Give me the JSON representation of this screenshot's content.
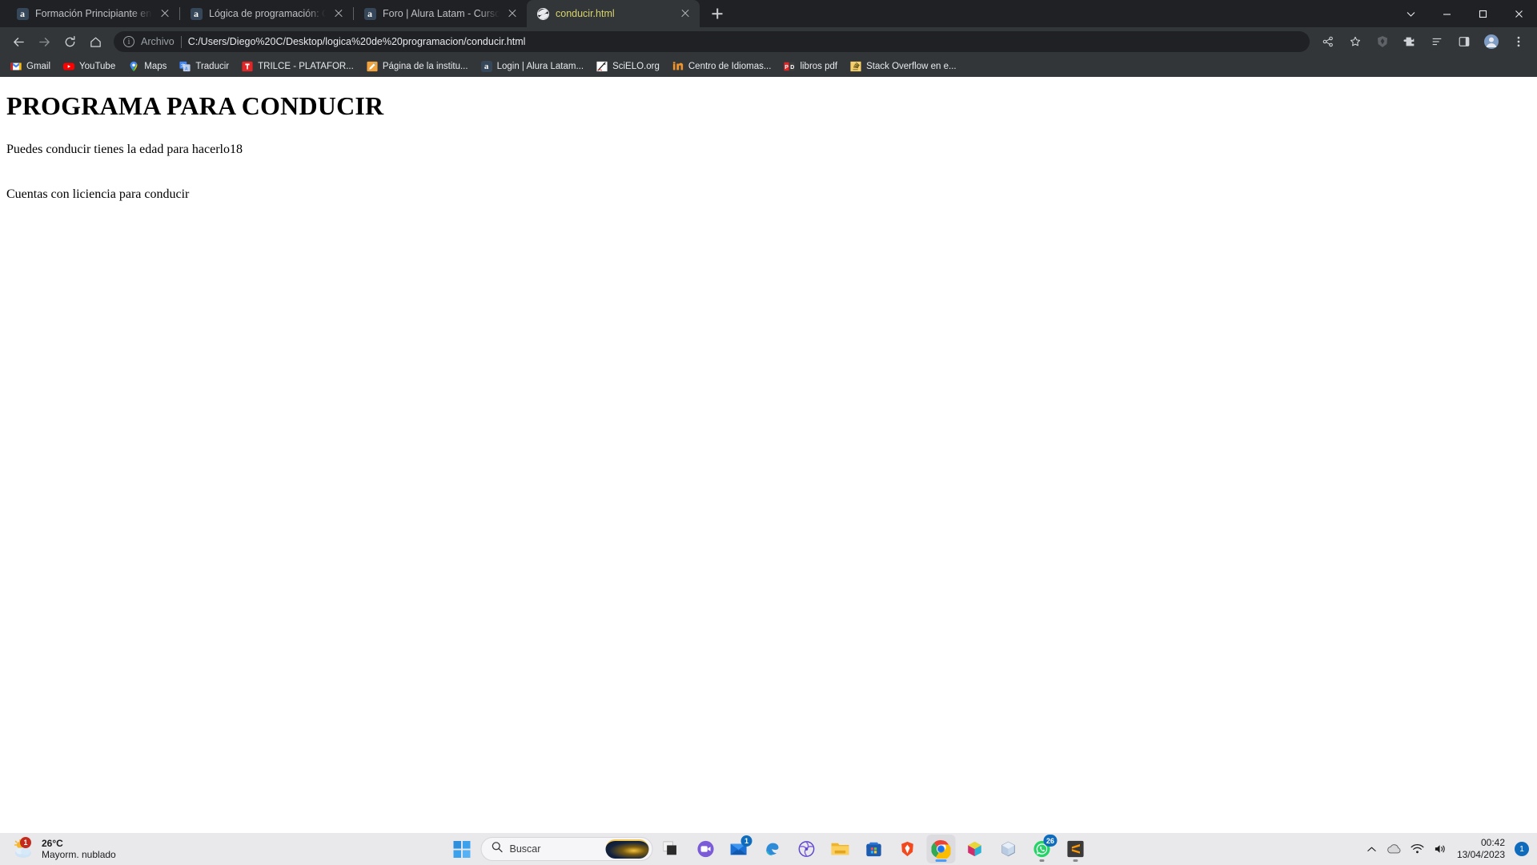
{
  "browser": {
    "tabs": [
      {
        "title": "Formación Principiante en Progra",
        "favicon": "amazon-a-icon",
        "active": false
      },
      {
        "title": "Lógica de programación: Concep",
        "favicon": "amazon-a-icon",
        "active": false
      },
      {
        "title": "Foro | Alura Latam - Cursos onlin",
        "favicon": "amazon-a-icon",
        "active": false
      },
      {
        "title": "conducir.html",
        "favicon": "globe-icon",
        "active": true
      }
    ],
    "new_tab_label": "+",
    "window_controls": {
      "minimize": "–",
      "maximize": "□",
      "close": "✕",
      "caret": "⌄"
    },
    "toolbar": {
      "back": "back-arrow-icon",
      "forward": "forward-arrow-icon",
      "reload": "reload-icon",
      "home": "home-icon",
      "scheme_label": "Archivo",
      "url": "C:/Users/Diego%20C/Desktop/logica%20de%20programacion/conducir.html",
      "share_icon": "share-icon",
      "bookmark_star": "star-icon",
      "brave_icon": "brave-lion-icon",
      "extensions_icon": "puzzle-piece-icon",
      "reading_list_icon": "reading-list-icon",
      "side_panel_icon": "side-panel-icon",
      "profile_icon": "profile-avatar-icon",
      "menu_icon": "three-dots-menu-icon"
    },
    "bookmarks": [
      {
        "label": "Gmail",
        "icon": "gmail-icon"
      },
      {
        "label": "YouTube",
        "icon": "youtube-icon"
      },
      {
        "label": "Maps",
        "icon": "google-maps-pin-icon"
      },
      {
        "label": "Traducir",
        "icon": "google-translate-icon"
      },
      {
        "label": "TRILCE - PLATAFOR...",
        "icon": "trilce-icon"
      },
      {
        "label": "Página de la institu...",
        "icon": "pencil-icon"
      },
      {
        "label": "Login | Alura Latam...",
        "icon": "amazon-a-icon"
      },
      {
        "label": "SciELO.org",
        "icon": "scielo-icon"
      },
      {
        "label": "Centro de Idiomas...",
        "icon": "idiomas-icon"
      },
      {
        "label": "libros pdf",
        "icon": "pdf-icon"
      },
      {
        "label": "Stack Overflow en e...",
        "icon": "stack-overflow-icon"
      }
    ]
  },
  "page": {
    "heading": "PROGRAMA PARA CONDUCIR",
    "paragraph1": "Puedes conducir tienes la edad para hacerlo18",
    "paragraph2": "Cuentas con liciencia para conducir"
  },
  "taskbar": {
    "weather": {
      "temperature": "26°C",
      "condition": "Mayorm. nublado",
      "badge": "1",
      "icon": "sun-behind-cloud-icon"
    },
    "start_icon": "windows-start-icon",
    "search": {
      "placeholder": "Buscar",
      "icon": "search-icon",
      "thumbnail": "galaxy-thumbnail"
    },
    "items": [
      {
        "name": "task-view",
        "icon": "task-view-icon",
        "badge": "",
        "running": false,
        "active": false
      },
      {
        "name": "chat",
        "icon": "chat-video-icon",
        "badge": "",
        "running": false,
        "active": false
      },
      {
        "name": "mail",
        "icon": "mail-icon",
        "badge": "1",
        "running": false,
        "active": false
      },
      {
        "name": "edge",
        "icon": "edge-icon",
        "badge": "",
        "running": false,
        "active": false
      },
      {
        "name": "app-swirl",
        "icon": "swirl-icon",
        "badge": "",
        "running": false,
        "active": false
      },
      {
        "name": "file-explorer",
        "icon": "file-explorer-icon",
        "badge": "",
        "running": false,
        "active": false
      },
      {
        "name": "microsoft-store",
        "icon": "microsoft-store-icon",
        "badge": "",
        "running": false,
        "active": false
      },
      {
        "name": "brave",
        "icon": "brave-lion-icon",
        "badge": "",
        "running": false,
        "active": false
      },
      {
        "name": "chrome",
        "icon": "chrome-icon",
        "badge": "",
        "running": true,
        "active": true
      },
      {
        "name": "unity",
        "icon": "colored-cube-icon",
        "badge": "",
        "running": false,
        "active": false
      },
      {
        "name": "virtualbox",
        "icon": "blue-cube-icon",
        "badge": "",
        "running": false,
        "active": false
      },
      {
        "name": "whatsapp",
        "icon": "whatsapp-icon",
        "badge": "26",
        "running": true,
        "active": false
      },
      {
        "name": "sublime-text",
        "icon": "sublime-text-icon",
        "badge": "",
        "running": true,
        "active": false
      }
    ],
    "tray": {
      "overflow_icon": "chevron-up-icon",
      "onedrive_icon": "cloud-icon",
      "wifi_icon": "wifi-icon",
      "volume_icon": "speaker-icon",
      "time": "00:42",
      "date": "13/04/2023",
      "notification_count": "1"
    }
  }
}
